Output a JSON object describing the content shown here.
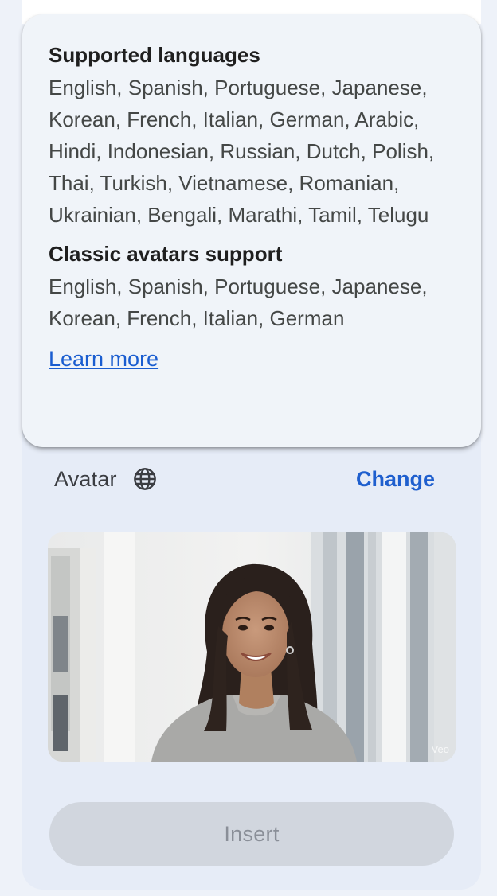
{
  "popover": {
    "supported_heading": "Supported languages",
    "supported_list": "English, Spanish, Portuguese, Japanese, Korean, French, Italian, German, Arabic, Hindi, Indonesian, Russian, Dutch, Polish, Thai, Turkish, Vietnamese, Romanian, Ukrainian, Bengali, Marathi, Tamil, Telugu",
    "classic_heading": "Classic avatars support",
    "classic_list": "English, Spanish, Portuguese, Japanese, Korean, French, Italian, German",
    "learn_more": "Learn more"
  },
  "avatar_panel": {
    "label": "Avatar",
    "language_icon": "globe-icon",
    "change_label": "Change",
    "preview_watermark": "Veo",
    "insert_label": "Insert",
    "insert_enabled": false
  },
  "colors": {
    "link": "#1f5fce",
    "panel_bg": "#e6ecf7",
    "popover_bg": "#f0f4f9",
    "disabled_button_bg": "#d1d6de"
  }
}
